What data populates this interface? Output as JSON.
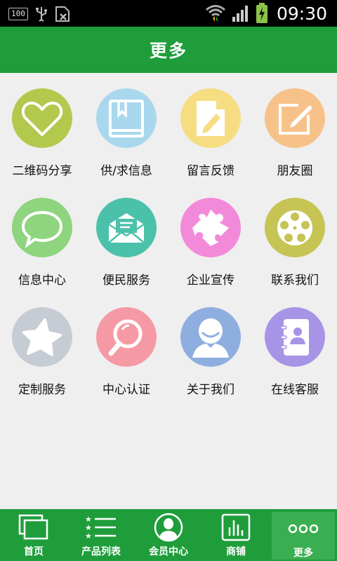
{
  "status_bar": {
    "left_badge": "100",
    "time": "09:30"
  },
  "header": {
    "title": "更多"
  },
  "grid": {
    "items": [
      {
        "label": "二维码分享",
        "color": "#b3c94e",
        "icon": "heart-icon"
      },
      {
        "label": "供/求信息",
        "color": "#a9d7ee",
        "icon": "book-icon"
      },
      {
        "label": "留言反馈",
        "color": "#f6dd82",
        "icon": "document-pencil-icon"
      },
      {
        "label": "朋友圈",
        "color": "#f6c28a",
        "icon": "edit-square-icon"
      },
      {
        "label": "信息中心",
        "color": "#8fd47e",
        "icon": "chat-bubble-icon"
      },
      {
        "label": "便民服务",
        "color": "#4cc1aa",
        "icon": "envelope-icon"
      },
      {
        "label": "企业宣传",
        "color": "#f28ad9",
        "icon": "puzzle-icon"
      },
      {
        "label": "联系我们",
        "color": "#c5c455",
        "icon": "film-reel-icon"
      },
      {
        "label": "定制服务",
        "color": "#c6ccd3",
        "icon": "star-icon"
      },
      {
        "label": "中心认证",
        "color": "#f59aa4",
        "icon": "magnifier-icon"
      },
      {
        "label": "关于我们",
        "color": "#8faee0",
        "icon": "user-icon"
      },
      {
        "label": "在线客服",
        "color": "#a894e6",
        "icon": "contact-book-icon"
      }
    ]
  },
  "bottom_nav": {
    "tabs": [
      {
        "label": "首页",
        "icon": "home-windows-icon"
      },
      {
        "label": "产品列表",
        "icon": "list-icon"
      },
      {
        "label": "会员中心",
        "icon": "member-icon"
      },
      {
        "label": "商铺",
        "icon": "shop-chart-icon"
      },
      {
        "label": "更多",
        "icon": "more-dots-icon",
        "active": true
      }
    ]
  }
}
